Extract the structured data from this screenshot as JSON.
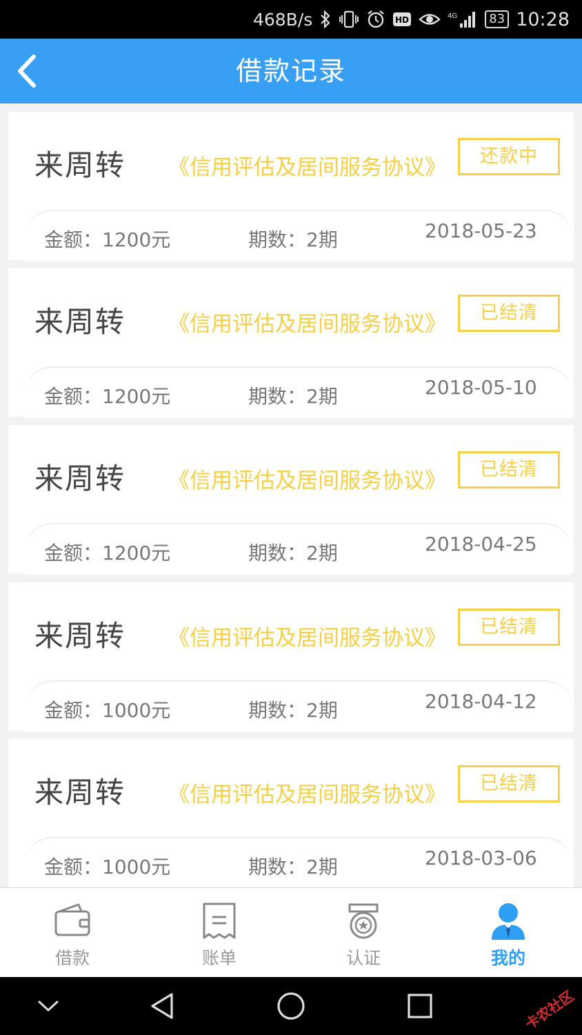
{
  "status_bar": {
    "net_speed": "468B/s",
    "signal_label": "4G",
    "battery": "83",
    "time": "10:28"
  },
  "header": {
    "title": "借款记录",
    "back_icon": "chevron-left-icon"
  },
  "records": [
    {
      "lender": "来周转",
      "agreement": "《信用评估及居间服务协议》",
      "status": "还款中",
      "amount": "金额：1200元",
      "terms": "期数：2期",
      "date": "2018-05-23"
    },
    {
      "lender": "来周转",
      "agreement": "《信用评估及居间服务协议》",
      "status": "已结清",
      "amount": "金额：1200元",
      "terms": "期数：2期",
      "date": "2018-05-10"
    },
    {
      "lender": "来周转",
      "agreement": "《信用评估及居间服务协议》",
      "status": "已结清",
      "amount": "金额：1200元",
      "terms": "期数：2期",
      "date": "2018-04-25"
    },
    {
      "lender": "来周转",
      "agreement": "《信用评估及居间服务协议》",
      "status": "已结清",
      "amount": "金额：1000元",
      "terms": "期数：2期",
      "date": "2018-04-12"
    },
    {
      "lender": "来周转",
      "agreement": "《信用评估及居间服务协议》",
      "status": "已结清",
      "amount": "金额：1000元",
      "terms": "期数：2期",
      "date": "2018-03-06"
    }
  ],
  "tabs": [
    {
      "label": "借款",
      "icon": "wallet-icon",
      "active": false
    },
    {
      "label": "账单",
      "icon": "receipt-icon",
      "active": false
    },
    {
      "label": "认证",
      "icon": "badge-icon",
      "active": false
    },
    {
      "label": "我的",
      "icon": "user-icon",
      "active": true
    }
  ],
  "nav_bar": {
    "buttons": [
      "collapse-icon",
      "back-triangle-icon",
      "home-circle-icon",
      "recents-square-icon"
    ],
    "watermark": "卡农社区"
  },
  "colors": {
    "primary": "#38a0f4",
    "accent_yellow": "#f6cf45",
    "active_tab": "#2f9ff3"
  }
}
